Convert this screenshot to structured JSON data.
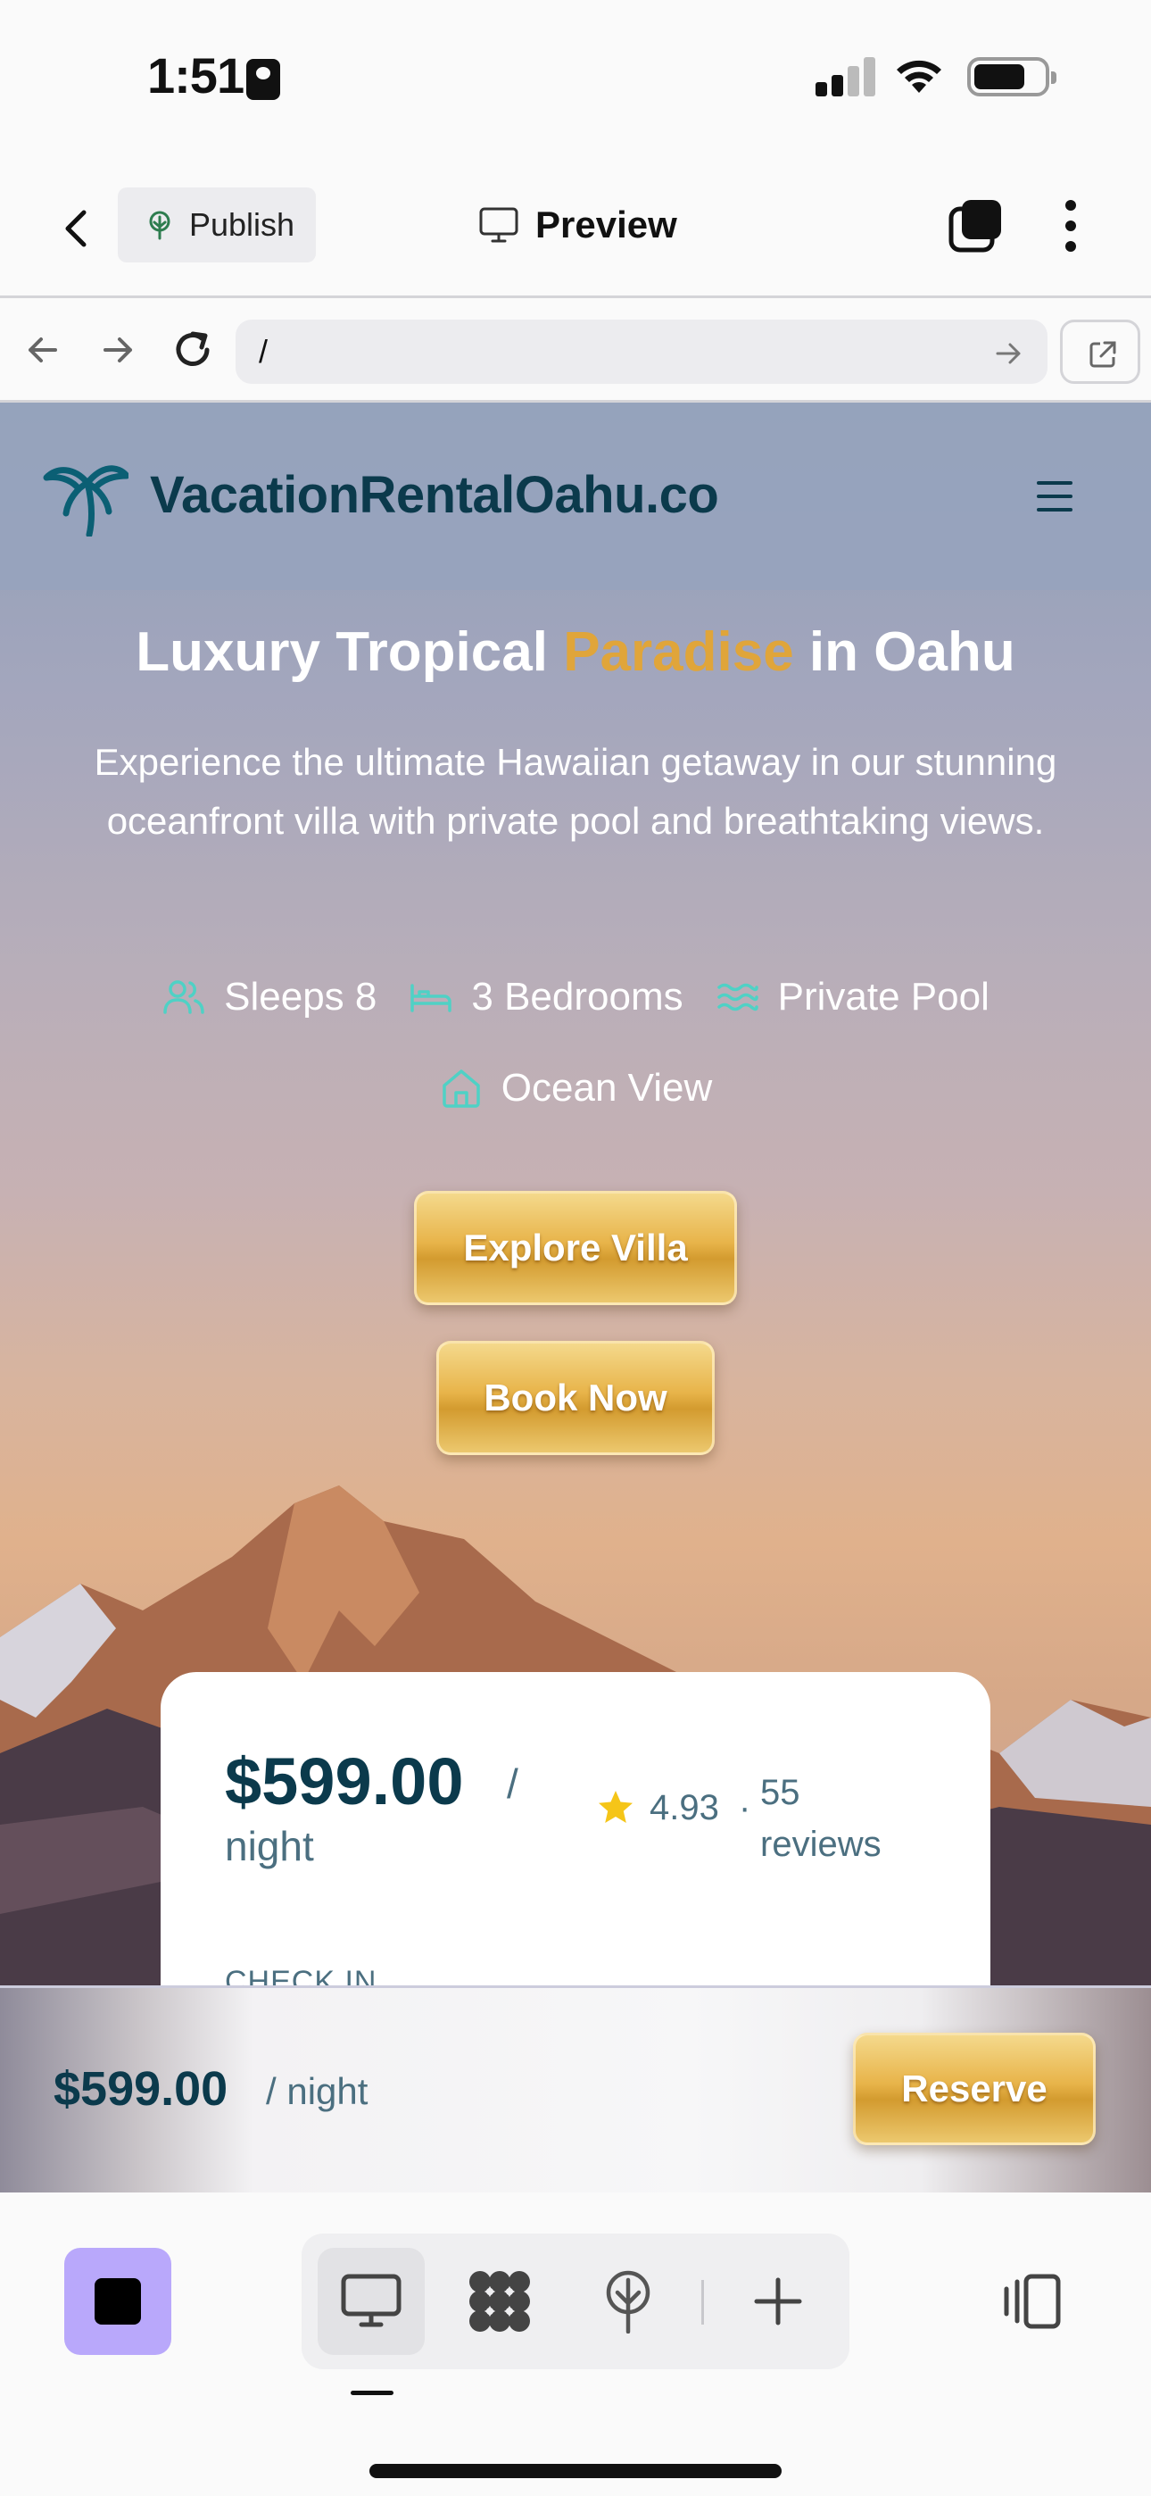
{
  "status_bar": {
    "time": "1:51"
  },
  "app_bar": {
    "publish_label": "Publish",
    "preview_label": "Preview"
  },
  "browser": {
    "url": "/"
  },
  "site": {
    "logo_text": "VacationRentalOahu.co",
    "hero": {
      "title_before": "Luxury Tropical ",
      "title_accent": "Paradise",
      "title_after": " in Oahu",
      "subtitle": "Experience the ultimate Hawaiian getaway in our stunning oceanfront villa with private pool and breathtaking views."
    },
    "features": [
      {
        "icon": "users-icon",
        "label": "Sleeps 8"
      },
      {
        "icon": "bed-icon",
        "label": "3 Bedrooms"
      },
      {
        "icon": "waves-icon",
        "label": "Private Pool"
      },
      {
        "icon": "home-icon",
        "label": "Ocean View"
      }
    ],
    "explore_label": "Explore Villa",
    "book_label": "Book Now",
    "booking_card": {
      "price": "$599.00",
      "slash": "/",
      "per": "night",
      "rating": "4.93",
      "separator": "·",
      "reviews": "55 reviews",
      "checkin_label": "CHECK IN"
    },
    "reserve_bar": {
      "price": "$599.00",
      "per": "/ night",
      "button_label": "Reserve"
    }
  },
  "colors": {
    "accent_gold": "#e0a53a",
    "brand_teal": "#0b3a4c",
    "feature_icon": "#4fd1c5",
    "stop_button": "#b9a8fb"
  }
}
